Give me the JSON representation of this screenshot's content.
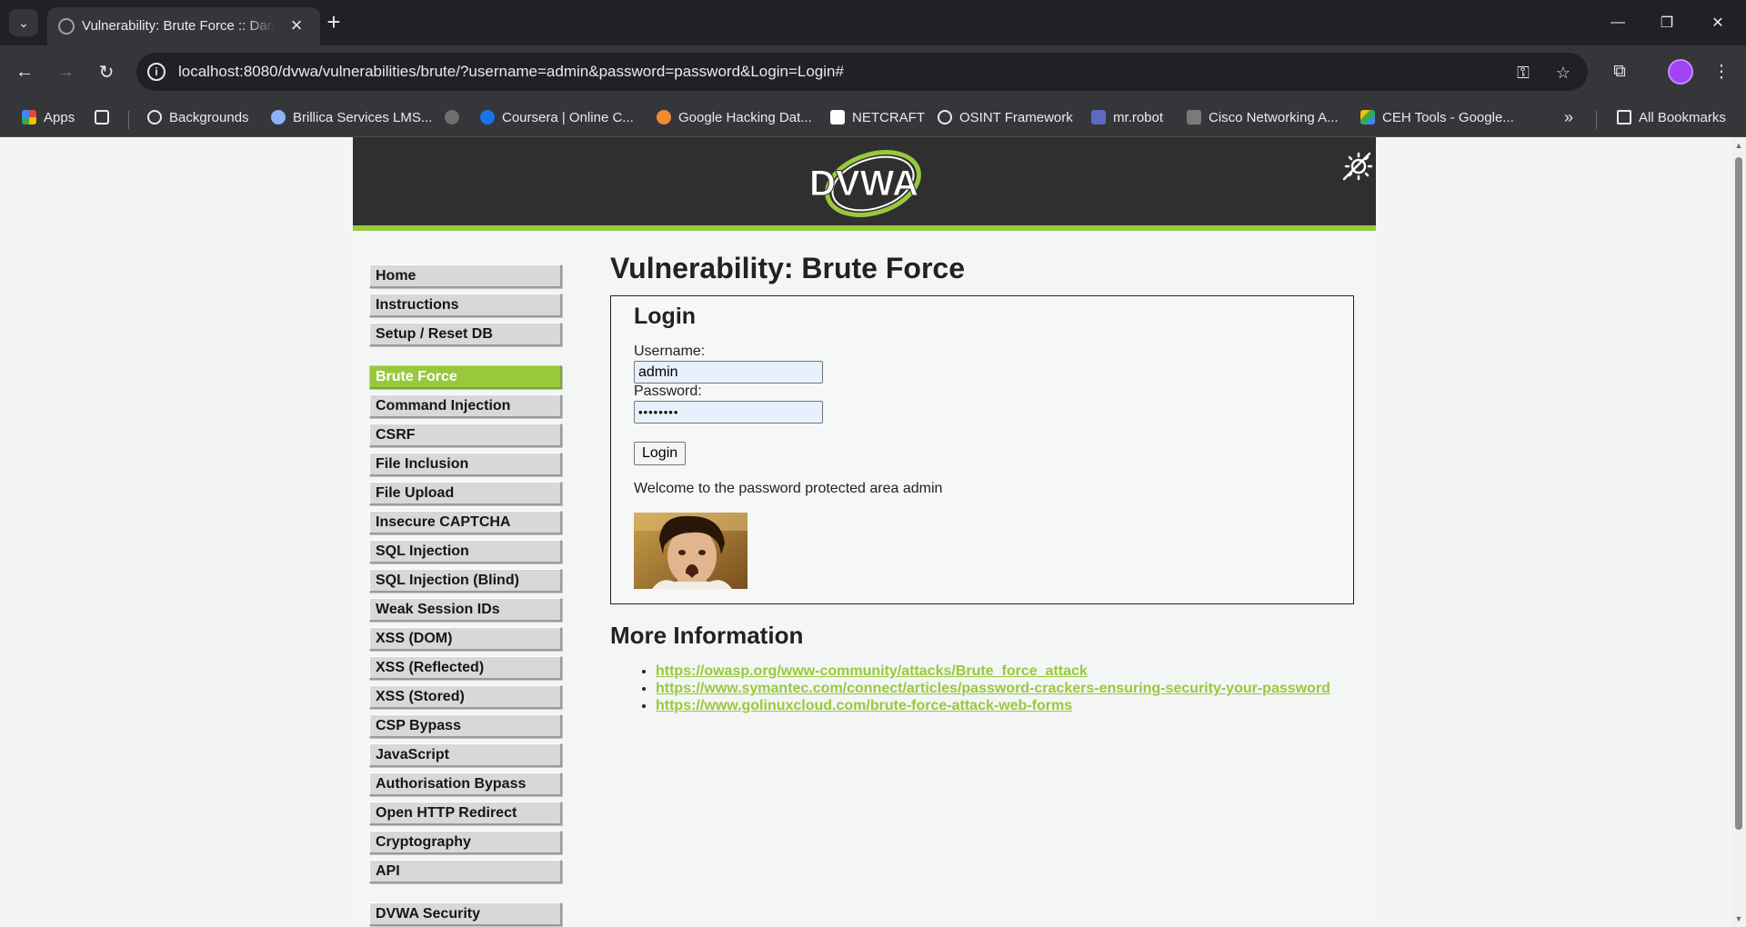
{
  "browser": {
    "tab_title": "Vulnerability: Brute Force :: Damn Vulnerable Web Application (DVWA)",
    "url": "localhost:8080/dvwa/vulnerabilities/brute/?username=admin&password=password&Login=Login#",
    "window_controls": {
      "minimize": "—",
      "restore": "❐",
      "close": "✕"
    }
  },
  "bookmarks": [
    {
      "label": "Apps",
      "icon": "apps-grid-icon",
      "color": "#ea4335"
    },
    {
      "label": "Backgrounds",
      "icon": "globe-icon",
      "color": "#e8eaed"
    },
    {
      "label": "Brillica Services LMS...",
      "icon": "brillica-icon",
      "color": "#8ab4f8"
    },
    {
      "label": "",
      "icon": "site-icon",
      "color": "#9aa0a6"
    },
    {
      "label": "Coursera | Online C...",
      "icon": "coursera-icon",
      "color": "#1a73e8"
    },
    {
      "label": "Google Hacking Dat...",
      "icon": "exploitdb-icon",
      "color": "#f28b30"
    },
    {
      "label": "NETCRAFT",
      "icon": "netcraft-icon",
      "color": "#ffffff"
    },
    {
      "label": "OSINT Framework",
      "icon": "globe-icon",
      "color": "#e8eaed"
    },
    {
      "label": "mr.robot",
      "icon": "mrrobot-icon",
      "color": "#5c6bc0"
    },
    {
      "label": "Cisco Networking A...",
      "icon": "cisco-icon",
      "color": "#9aa0a6"
    },
    {
      "label": "CEH Tools - Google...",
      "icon": "drive-icon",
      "color": "#fbbc04"
    }
  ],
  "all_bookmarks_label": "All Bookmarks",
  "dvwa": {
    "logo_text": "DVWA",
    "menu_groups": [
      [
        "Home",
        "Instructions",
        "Setup / Reset DB"
      ],
      [
        "Brute Force",
        "Command Injection",
        "CSRF",
        "File Inclusion",
        "File Upload",
        "Insecure CAPTCHA",
        "SQL Injection",
        "SQL Injection (Blind)",
        "Weak Session IDs",
        "XSS (DOM)",
        "XSS (Reflected)",
        "XSS (Stored)",
        "CSP Bypass",
        "JavaScript",
        "Authorisation Bypass",
        "Open HTTP Redirect",
        "Cryptography",
        "API"
      ],
      [
        "DVWA Security"
      ]
    ],
    "selected_menu": "Brute Force",
    "page_title": "Vulnerability: Brute Force",
    "login": {
      "heading": "Login",
      "username_label": "Username:",
      "username_value": "admin",
      "password_label": "Password:",
      "password_masked": "••••••••",
      "button": "Login",
      "welcome": "Welcome to the password protected area admin"
    },
    "more_info": {
      "heading": "More Information",
      "links": [
        "https://owasp.org/www-community/attacks/Brute_force_attack",
        "https://www.symantec.com/connect/articles/password-crackers-ensuring-security-your-password",
        "https://www.golinuxcloud.com/brute-force-attack-web-forms"
      ]
    }
  },
  "colors": {
    "accent": "#98c93c",
    "header": "#2f2f2f",
    "chrome": "#35363a"
  }
}
